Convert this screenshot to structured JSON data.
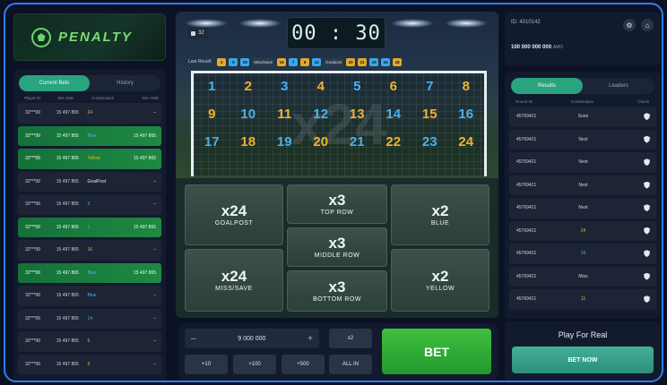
{
  "brand": {
    "name": "PENALTY"
  },
  "left_panel": {
    "tabs": [
      "Current Bets",
      "History"
    ],
    "headers": [
      "Player ID",
      "Bet AMD",
      "Combination",
      "Win AMD"
    ],
    "rows": [
      {
        "player": "32***99",
        "bet": "15 497 865",
        "combo": "24",
        "win": "–",
        "style": "plain",
        "combo_color": "yellow"
      },
      {
        "player": "32***99",
        "bet": "15 497 865",
        "combo": "Blue",
        "win": "15 497 865",
        "style": "win",
        "combo_color": "blue"
      },
      {
        "player": "32***99",
        "bet": "15 497 865",
        "combo": "Yellow",
        "win": "15 497 865",
        "style": "win",
        "combo_color": "yellow"
      },
      {
        "player": "32***99",
        "bet": "15 497 865",
        "combo": "GoalPost",
        "win": "–",
        "style": "plain",
        "combo_color": "white"
      },
      {
        "player": "32***99",
        "bet": "15 497 865",
        "combo": "3",
        "win": "–",
        "style": "plain",
        "combo_color": "blue"
      },
      {
        "player": "32***99",
        "bet": "15 497 865",
        "combo": "1",
        "win": "15 497 865",
        "style": "win",
        "combo_color": "blue"
      },
      {
        "player": "32***99",
        "bet": "15 497 865",
        "combo": "16",
        "win": "–",
        "style": "plain",
        "combo_color": "yellow"
      },
      {
        "player": "32***99",
        "bet": "15 497 865",
        "combo": "Blue",
        "win": "15 497 865",
        "style": "win",
        "combo_color": "blue"
      },
      {
        "player": "32***99",
        "bet": "15 497 865",
        "combo": "Blue",
        "win": "–",
        "style": "plain",
        "combo_color": "blue"
      },
      {
        "player": "32***99",
        "bet": "15 497 865",
        "combo": "14",
        "win": "–",
        "style": "plain",
        "combo_color": "blue"
      },
      {
        "player": "32***99",
        "bet": "15 497 865",
        "combo": "6",
        "win": "–",
        "style": "plain",
        "combo_color": "yellow"
      },
      {
        "player": "32***99",
        "bet": "15 497 865",
        "combo": "9",
        "win": "–",
        "style": "plain",
        "combo_color": "yellow"
      }
    ]
  },
  "game": {
    "timer": "00 : 30",
    "round_badge": "32",
    "last_result_label": "Last Result:",
    "last_results": [
      {
        "text": "2",
        "c": "y"
      },
      {
        "text": "5",
        "c": "b"
      },
      {
        "text": "25",
        "c": "b"
      },
      {
        "text": "Miss/Save",
        "c": "t"
      },
      {
        "text": "15",
        "c": "y"
      },
      {
        "text": "7",
        "c": "b"
      },
      {
        "text": "8",
        "c": "y"
      },
      {
        "text": "24",
        "c": "b"
      },
      {
        "text": "Goalpost",
        "c": "t"
      },
      {
        "text": "20",
        "c": "y"
      },
      {
        "text": "21",
        "c": "y"
      },
      {
        "text": "19",
        "c": "b"
      },
      {
        "text": "16",
        "c": "b"
      },
      {
        "text": "18",
        "c": "y"
      }
    ],
    "watermark": "x24",
    "goal_numbers": [
      {
        "n": "1",
        "c": "b"
      },
      {
        "n": "2",
        "c": "y"
      },
      {
        "n": "3",
        "c": "b"
      },
      {
        "n": "4",
        "c": "y"
      },
      {
        "n": "5",
        "c": "b"
      },
      {
        "n": "6",
        "c": "y"
      },
      {
        "n": "7",
        "c": "b"
      },
      {
        "n": "8",
        "c": "y"
      },
      {
        "n": "9",
        "c": "y"
      },
      {
        "n": "10",
        "c": "b"
      },
      {
        "n": "11",
        "c": "y"
      },
      {
        "n": "12",
        "c": "b"
      },
      {
        "n": "13",
        "c": "y"
      },
      {
        "n": "14",
        "c": "b"
      },
      {
        "n": "15",
        "c": "y"
      },
      {
        "n": "16",
        "c": "b"
      },
      {
        "n": "17",
        "c": "b"
      },
      {
        "n": "18",
        "c": "y"
      },
      {
        "n": "19",
        "c": "b"
      },
      {
        "n": "20",
        "c": "y"
      },
      {
        "n": "21",
        "c": "b"
      },
      {
        "n": "22",
        "c": "y"
      },
      {
        "n": "23",
        "c": "b"
      },
      {
        "n": "24",
        "c": "y"
      }
    ],
    "bet_options": {
      "goalpost": {
        "mult": "x24",
        "label": "GOALPOST"
      },
      "miss": {
        "mult": "x24",
        "label": "MISS/SAVE"
      },
      "top": {
        "mult": "x3",
        "label": "TOP ROW"
      },
      "middle": {
        "mult": "x3",
        "label": "MIDDLE ROW"
      },
      "bottom": {
        "mult": "x3",
        "label": "BOTTOM ROW"
      },
      "blue": {
        "mult": "x2",
        "label": "BLUE"
      },
      "yellow": {
        "mult": "x2",
        "label": "YELLOW"
      }
    }
  },
  "controls": {
    "amount": "9 000 000",
    "minus": "–",
    "plus": "+",
    "x2": "x2",
    "quick": [
      "+10",
      "+100",
      "+500"
    ],
    "all_in": "ALL IN",
    "bet": "BET"
  },
  "user": {
    "id": "ID: 4010142",
    "balance": "100 000 000 000",
    "currency": "AMD"
  },
  "right_panel": {
    "tabs": [
      "Results",
      "Leaders"
    ],
    "headers": [
      "Round ID",
      "Combination",
      "Check"
    ],
    "rows": [
      {
        "round": "45769421",
        "combo": "Soon",
        "c": ""
      },
      {
        "round": "45769421",
        "combo": "Next",
        "c": ""
      },
      {
        "round": "45769421",
        "combo": "Next",
        "c": ""
      },
      {
        "round": "45769421",
        "combo": "Next",
        "c": ""
      },
      {
        "round": "45769421",
        "combo": "Next",
        "c": ""
      },
      {
        "round": "45769421",
        "combo": "24",
        "c": "y"
      },
      {
        "round": "45769421",
        "combo": "10",
        "c": "b"
      },
      {
        "round": "45769421",
        "combo": "Miss",
        "c": ""
      },
      {
        "round": "45769421",
        "combo": "11",
        "c": "y"
      }
    ]
  },
  "promo": {
    "title": "Play For Real",
    "button": "BET NOW"
  }
}
